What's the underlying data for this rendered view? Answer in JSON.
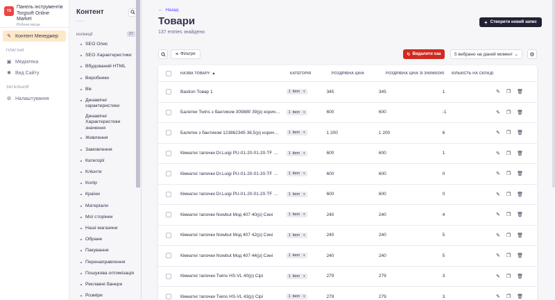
{
  "brand": {
    "title": "Панель інструментів Torgsoft Online Market",
    "subtitle": "Робоче місце"
  },
  "nav": {
    "main_item": "Контент Менеджер",
    "section_plugins": "ПЛАГІНИ",
    "plugins": [
      "Медіатека",
      "Вид Сайту"
    ],
    "section_general": "ЗАГАЛЬНІЙ",
    "general": [
      "Налаштування"
    ]
  },
  "subnav": {
    "title": "Контент",
    "collections_label": "колекції",
    "collections_count": "27",
    "items": [
      "SEO Опис",
      "SEO Характеристики",
      "Вбудований HTML",
      "Виробники",
      "Вік",
      "Динамічні характеристики",
      "Динамічні Характеристики значення",
      "Живлення",
      "Замовлення",
      "Категорії",
      "Клієнти",
      "Колір",
      "Країни",
      "Матеріали",
      "Мої сторінки",
      "Наші магазини",
      "Обране",
      "Пакування",
      "Перенаправлення",
      "Пошукова оптимізація",
      "Рекламні банери",
      "Розміри"
    ]
  },
  "header": {
    "back": "Назад",
    "title": "Товари",
    "entries": "137 entries знайдено",
    "create": "Створити новий запис"
  },
  "toolbar": {
    "filters": "Фільтри",
    "delete_all": "Видалити хаа",
    "selected": "5 вибрано на даний момент"
  },
  "table": {
    "columns": [
      "НАЗВА ТОВАРУ",
      "КАТЕГОРІЯ",
      "РОЗДРІБНА ЦІНА",
      "РОЗДРІБНА ЦІНА ЗІ ЗНИЖКОЮ",
      "КІЛЬКІСТЬ НА СКЛАДІ"
    ],
    "rows": [
      {
        "name": "Bastion Товар 1",
        "cat": "1",
        "cat_unit": "item",
        "price": "345",
        "dprice": "345",
        "qty": "1"
      },
      {
        "name": "Балетки Twins з бантиком 309880 39(р) корич…",
        "cat": "1",
        "cat_unit": "item",
        "price": "600",
        "dprice": "600",
        "qty": "-1"
      },
      {
        "name": "Балетки з бантиком 123862345 38,5(р) корич…",
        "cat": "1",
        "cat_unit": "item",
        "price": "1 200",
        "dprice": "1 200",
        "qty": "6"
      },
      {
        "name": "Кімнатні тапочки Dr.Luigi PU-01-20-01-20-TF …",
        "cat": "1",
        "cat_unit": "item",
        "price": "600",
        "dprice": "600",
        "qty": "1"
      },
      {
        "name": "Кімнатні тапочки Dr.Luigi PU-01-20-01-20-TF …",
        "cat": "1",
        "cat_unit": "item",
        "price": "600",
        "dprice": "600",
        "qty": "0"
      },
      {
        "name": "Кімнатні тапочки Dr.Luigi PU-01-20-01-20-TF …",
        "cat": "1",
        "cat_unit": "item",
        "price": "600",
        "dprice": "600",
        "qty": "0"
      },
      {
        "name": "Кімнатні тапочки Nowbut Мод 407 40(р) Сині",
        "cat": "1",
        "cat_unit": "item",
        "price": "240",
        "dprice": "240",
        "qty": "4"
      },
      {
        "name": "Кімнатні тапочки Nowbut Мод 407 42(р) Сині",
        "cat": "1",
        "cat_unit": "item",
        "price": "240",
        "dprice": "240",
        "qty": "5"
      },
      {
        "name": "Кімнатні тапочки Nowbut Мод 407 44(р) Сині",
        "cat": "1",
        "cat_unit": "item",
        "price": "240",
        "dprice": "240",
        "qty": "5"
      },
      {
        "name": "Кімнатні тапочки Twins HS-VL 40(р) Сірі",
        "cat": "1",
        "cat_unit": "item",
        "price": "279",
        "dprice": "279",
        "qty": "3"
      },
      {
        "name": "Кімнатні тапочки Twins HS-VL 43(р) Сірі",
        "cat": "1",
        "cat_unit": "item",
        "price": "279",
        "dprice": "279",
        "qty": "3"
      }
    ]
  },
  "colors": {
    "accent": "#4945ff",
    "danger": "#d02b20",
    "dark": "#212134",
    "active_nav": "#fde8c8"
  }
}
